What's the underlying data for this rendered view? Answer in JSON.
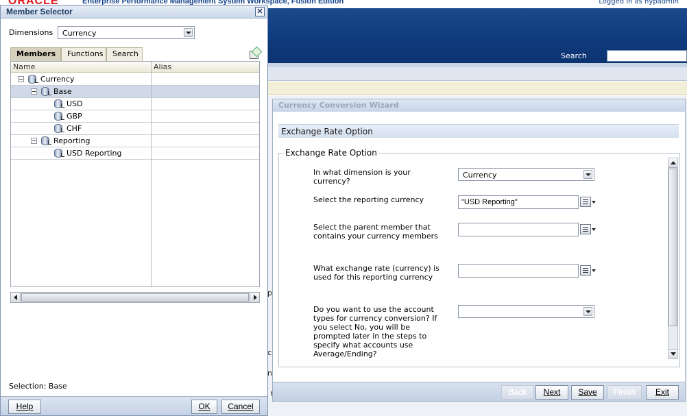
{
  "workspace": {
    "brand": "ORACLE",
    "title": "Enterprise Performance Management System Workspace, Fusion Edition",
    "logged_in": "Logged in as hypadmin",
    "search_label": "Search",
    "search_value": ""
  },
  "background_fragments": [
    "p",
    "cu",
    "no",
    "t"
  ],
  "wizard": {
    "title": "Currency Conversion Wizard",
    "section_header": "Exchange Rate Option",
    "fieldset_legend": "Exchange Rate Option",
    "questions": [
      {
        "label": "In what dimension is your currency?",
        "control": "select",
        "value": "Currency"
      },
      {
        "label": "Select the reporting currency",
        "control": "picker",
        "value": "\"USD Reporting\""
      },
      {
        "label": "Select the parent member that contains your currency members",
        "control": "picker",
        "value": ""
      },
      {
        "label": "What exchange rate (currency) is used for this reporting currency",
        "control": "picker",
        "value": ""
      },
      {
        "label": "Do you want to use the account types for currency conversion? If you select No, you will be prompted later in the steps to specify what accounts use Average/Ending?",
        "control": "select",
        "value": ""
      }
    ],
    "buttons": {
      "back": {
        "label": "Back",
        "enabled": false
      },
      "next": {
        "label": "Next",
        "enabled": true
      },
      "save": {
        "label": "Save",
        "enabled": true
      },
      "finish": {
        "label": "Finish",
        "enabled": false
      },
      "exit": {
        "label": "Exit",
        "enabled": true
      }
    }
  },
  "member_selector": {
    "title": "Member Selector",
    "close_glyph": "✕",
    "dimensions_label": "Dimensions",
    "dimension_value": "Currency",
    "tabs": [
      {
        "label": "Members",
        "active": true
      },
      {
        "label": "Functions",
        "active": false
      },
      {
        "label": "Search",
        "active": false
      }
    ],
    "columns": {
      "name": "Name",
      "alias": "Alias"
    },
    "tree": [
      {
        "label": "Currency",
        "level": 0,
        "expandable": true,
        "selected": false,
        "alias": ""
      },
      {
        "label": "Base",
        "level": 1,
        "expandable": true,
        "selected": true,
        "alias": ""
      },
      {
        "label": "USD",
        "level": 2,
        "expandable": false,
        "selected": false,
        "alias": ""
      },
      {
        "label": "GBP",
        "level": 2,
        "expandable": false,
        "selected": false,
        "alias": ""
      },
      {
        "label": "CHF",
        "level": 2,
        "expandable": false,
        "selected": false,
        "alias": ""
      },
      {
        "label": "Reporting",
        "level": 1,
        "expandable": true,
        "selected": false,
        "alias": ""
      },
      {
        "label": "USD Reporting",
        "level": 2,
        "expandable": false,
        "selected": false,
        "alias": ""
      }
    ],
    "selection_text": "Selection: Base",
    "buttons": {
      "help": "Help",
      "ok": "OK",
      "cancel": "Cancel"
    }
  },
  "colors": {
    "banner": "#0e3a7c",
    "brand_red": "#e0191e",
    "selected_row": "#cfd9e8",
    "active_tab": "#d6d1bd"
  }
}
